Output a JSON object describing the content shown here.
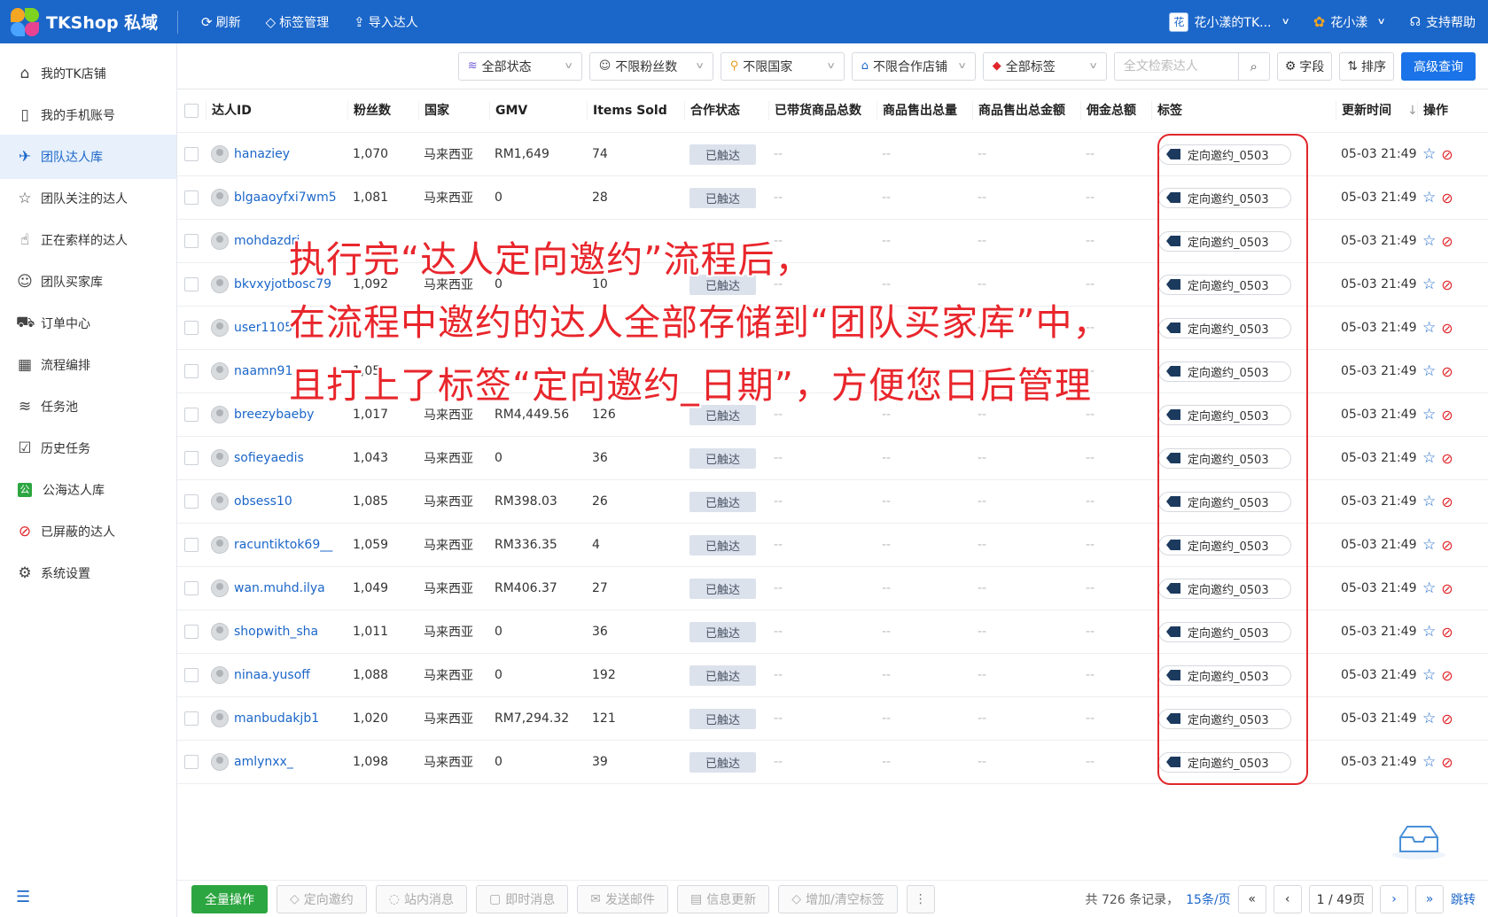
{
  "app": {
    "title": "TKShop 私域",
    "toolbar": [
      {
        "icon": "refresh-icon",
        "glyph": "⟳",
        "label": "刷新"
      },
      {
        "icon": "tag-icon",
        "glyph": "◇",
        "label": "标签管理"
      },
      {
        "icon": "import-icon",
        "glyph": "⇪",
        "label": "导入达人"
      }
    ],
    "shop_badge": "花",
    "shop_name": "花小漾的TK...",
    "user_name": "花小漾",
    "help": "支持帮助"
  },
  "sidebar": {
    "items": [
      {
        "icon": "store-icon",
        "glyph": "⌂",
        "label": "我的TK店铺"
      },
      {
        "icon": "phone-icon",
        "glyph": "▯",
        "label": "我的手机账号"
      },
      {
        "icon": "team-creator-icon",
        "glyph": "✈",
        "label": "团队达人库"
      },
      {
        "icon": "star-icon",
        "glyph": "☆",
        "label": "团队关注的达人"
      },
      {
        "icon": "hand-icon",
        "glyph": "☝",
        "label": "正在索样的达人"
      },
      {
        "icon": "buyer-icon",
        "glyph": "☺",
        "label": "团队买家库"
      },
      {
        "icon": "truck-icon",
        "glyph": "⛟",
        "label": "订单中心"
      },
      {
        "icon": "calendar-icon",
        "glyph": "▦",
        "label": "流程编排"
      },
      {
        "icon": "layers-icon",
        "glyph": "≋",
        "label": "任务池"
      },
      {
        "icon": "history-icon",
        "glyph": "☑",
        "label": "历史任务"
      },
      {
        "icon": "public-icon",
        "glyph": "公",
        "label": "公海达人库"
      },
      {
        "icon": "block-icon",
        "glyph": "⊘",
        "label": "已屏蔽的达人"
      },
      {
        "icon": "settings-icon",
        "glyph": "⚙",
        "label": "系统设置"
      }
    ],
    "active_index": 2
  },
  "filters": {
    "selects": [
      {
        "icon": "layers-icon",
        "label": "全部状态"
      },
      {
        "icon": "person-icon",
        "label": "不限粉丝数"
      },
      {
        "icon": "pin-icon",
        "label": "不限国家"
      },
      {
        "icon": "store-icon",
        "label": "不限合作店铺"
      },
      {
        "icon": "tag-icon",
        "label": "全部标签"
      }
    ],
    "search_placeholder": "全文检索达人",
    "fields_label": "字段",
    "sort_label": "排序",
    "advanced_label": "高级查询"
  },
  "table": {
    "columns": [
      "达人ID",
      "粉丝数",
      "国家",
      "GMV",
      "Items Sold",
      "合作状态",
      "已带货商品总数",
      "商品售出总量",
      "商品售出总金额",
      "佣金总额",
      "标签",
      "更新时间",
      "操作"
    ],
    "sort_indicator": "↓",
    "rows": [
      {
        "id": "hanaziey",
        "fans": "1,070",
        "country": "马来西亚",
        "gmv": "RM1,649",
        "sold": "74",
        "status": "已触达",
        "c7": "--",
        "c8": "--",
        "c9": "--",
        "c10": "--",
        "tag": "定向邀约_0503",
        "updated": "05-03 21:49"
      },
      {
        "id": "blgaaoyfxi7wm5",
        "fans": "1,081",
        "country": "马来西亚",
        "gmv": "0",
        "sold": "28",
        "status": "已触达",
        "c7": "--",
        "c8": "--",
        "c9": "--",
        "c10": "--",
        "tag": "定向邀约_0503",
        "updated": "05-03 21:49"
      },
      {
        "id": "mohdazdri",
        "fans": "",
        "country": "",
        "gmv": "",
        "sold": "",
        "status": "",
        "c7": "--",
        "c8": "--",
        "c9": "--",
        "c10": "--",
        "tag": "定向邀约_0503",
        "updated": "05-03 21:49"
      },
      {
        "id": "bkvxyjotbosc79",
        "fans": "1,092",
        "country": "马来西亚",
        "gmv": "0",
        "sold": "10",
        "status": "已触达",
        "c7": "--",
        "c8": "--",
        "c9": "--",
        "c10": "--",
        "tag": "定向邀约_0503",
        "updated": "05-03 21:49"
      },
      {
        "id": "user11054",
        "fans": "",
        "country": "",
        "gmv": "",
        "sold": "",
        "status": "",
        "c7": "--",
        "c8": "--",
        "c9": "--",
        "c10": "--",
        "tag": "定向邀约_0503",
        "updated": "05-03 21:49"
      },
      {
        "id": "naamn91",
        "fans": "1,05",
        "country": "",
        "gmv": "",
        "sold": "",
        "status": "",
        "c7": "--",
        "c8": "--",
        "c9": "--",
        "c10": "--",
        "tag": "定向邀约_0503",
        "updated": "05-03 21:49"
      },
      {
        "id": "breezybaeby",
        "fans": "1,017",
        "country": "马来西亚",
        "gmv": "RM4,449.56",
        "sold": "126",
        "status": "已触达",
        "c7": "--",
        "c8": "--",
        "c9": "--",
        "c10": "--",
        "tag": "定向邀约_0503",
        "updated": "05-03 21:49"
      },
      {
        "id": "sofieyaedis",
        "fans": "1,043",
        "country": "马来西亚",
        "gmv": "0",
        "sold": "36",
        "status": "已触达",
        "c7": "--",
        "c8": "--",
        "c9": "--",
        "c10": "--",
        "tag": "定向邀约_0503",
        "updated": "05-03 21:49"
      },
      {
        "id": "obsess10",
        "fans": "1,085",
        "country": "马来西亚",
        "gmv": "RM398.03",
        "sold": "26",
        "status": "已触达",
        "c7": "--",
        "c8": "--",
        "c9": "--",
        "c10": "--",
        "tag": "定向邀约_0503",
        "updated": "05-03 21:49"
      },
      {
        "id": "racuntiktok69__",
        "fans": "1,059",
        "country": "马来西亚",
        "gmv": "RM336.35",
        "sold": "4",
        "status": "已触达",
        "c7": "--",
        "c8": "--",
        "c9": "--",
        "c10": "--",
        "tag": "定向邀约_0503",
        "updated": "05-03 21:49"
      },
      {
        "id": "wan.muhd.ilya",
        "fans": "1,049",
        "country": "马来西亚",
        "gmv": "RM406.37",
        "sold": "27",
        "status": "已触达",
        "c7": "--",
        "c8": "--",
        "c9": "--",
        "c10": "--",
        "tag": "定向邀约_0503",
        "updated": "05-03 21:49"
      },
      {
        "id": "shopwith_sha",
        "fans": "1,011",
        "country": "马来西亚",
        "gmv": "0",
        "sold": "36",
        "status": "已触达",
        "c7": "--",
        "c8": "--",
        "c9": "--",
        "c10": "--",
        "tag": "定向邀约_0503",
        "updated": "05-03 21:49"
      },
      {
        "id": "ninaa.yusoff",
        "fans": "1,088",
        "country": "马来西亚",
        "gmv": "0",
        "sold": "192",
        "status": "已触达",
        "c7": "--",
        "c8": "--",
        "c9": "--",
        "c10": "--",
        "tag": "定向邀约_0503",
        "updated": "05-03 21:49"
      },
      {
        "id": "manbudakjb1",
        "fans": "1,020",
        "country": "马来西亚",
        "gmv": "RM7,294.32",
        "sold": "121",
        "status": "已触达",
        "c7": "--",
        "c8": "--",
        "c9": "--",
        "c10": "--",
        "tag": "定向邀约_0503",
        "updated": "05-03 21:49"
      },
      {
        "id": "amlynxx_",
        "fans": "1,098",
        "country": "马来西亚",
        "gmv": "0",
        "sold": "39",
        "status": "已触达",
        "c7": "--",
        "c8": "--",
        "c9": "--",
        "c10": "--",
        "tag": "定向邀约_0503",
        "updated": "05-03 21:49"
      }
    ]
  },
  "annotation": {
    "lines": [
      "执行完“达人定向邀约”流程后，",
      "在流程中邀约的达人全部存储到“团队买家库”中，",
      "且打上了标签“定向邀约_日期”，方便您日后管理"
    ]
  },
  "footer": {
    "bulk_label": "全量操作",
    "actions": [
      {
        "icon": "tag-icon",
        "glyph": "◇",
        "label": "定向邀约"
      },
      {
        "icon": "chat-icon",
        "glyph": "◌",
        "label": "站内消息"
      },
      {
        "icon": "message-icon",
        "glyph": "▢",
        "label": "即时消息"
      },
      {
        "icon": "mail-icon",
        "glyph": "✉",
        "label": "发送邮件"
      },
      {
        "icon": "doc-icon",
        "glyph": "▤",
        "label": "信息更新"
      },
      {
        "icon": "tag-icon",
        "glyph": "◇",
        "label": "增加/清空标签"
      }
    ],
    "more_glyph": "⋮",
    "total_text": "共 726 条记录，",
    "page_size": "15条/页",
    "page_info": "1 / 49页",
    "jump_label": "跳转"
  },
  "colors": {
    "brand": "#1b66c9",
    "highlight": "#e0262b",
    "annotation": "#e8262c",
    "bulk_button": "#2ca640"
  }
}
